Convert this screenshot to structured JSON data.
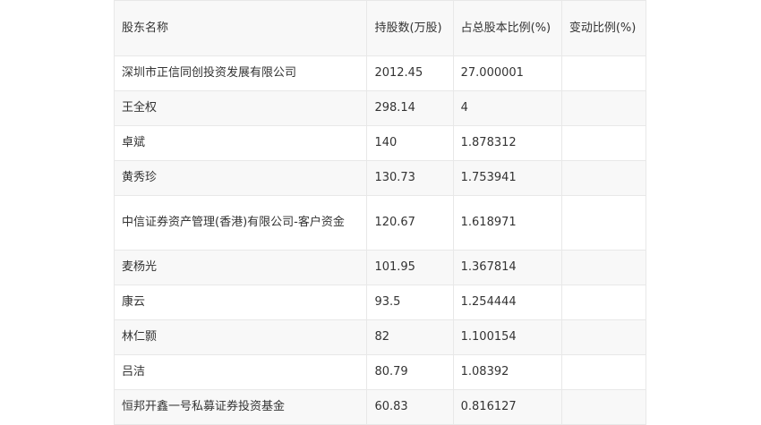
{
  "table": {
    "headers": [
      "股东名称",
      "持股数(万股)",
      "占总股本比例(%)",
      "变动比例(%)"
    ],
    "rows": [
      {
        "name": "深圳市正信同创投资发展有限公司",
        "shares": "2012.45",
        "ratio": "27.000001",
        "change": ""
      },
      {
        "name": "王全权",
        "shares": "298.14",
        "ratio": "4",
        "change": ""
      },
      {
        "name": "卓斌",
        "shares": "140",
        "ratio": "1.878312",
        "change": ""
      },
      {
        "name": "黄秀珍",
        "shares": "130.73",
        "ratio": "1.753941",
        "change": ""
      },
      {
        "name": "中信证券资产管理(香港)有限公司-客户资金",
        "shares": "120.67",
        "ratio": "1.618971",
        "change": ""
      },
      {
        "name": "麦杨光",
        "shares": "101.95",
        "ratio": "1.367814",
        "change": ""
      },
      {
        "name": "康云",
        "shares": "93.5",
        "ratio": "1.254444",
        "change": ""
      },
      {
        "name": "林仁颢",
        "shares": "82",
        "ratio": "1.100154",
        "change": ""
      },
      {
        "name": "吕洁",
        "shares": "80.79",
        "ratio": "1.08392",
        "change": ""
      },
      {
        "name": "恒邦开鑫一号私募证券投资基金",
        "shares": "60.83",
        "ratio": "0.816127",
        "change": ""
      }
    ]
  }
}
